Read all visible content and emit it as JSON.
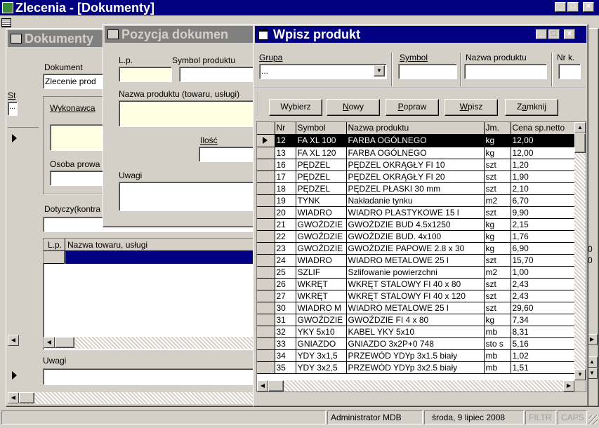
{
  "app": {
    "title": "Zlecenia - [Dokumenty]",
    "status": {
      "user": "Administrator MDB",
      "date": "środa, 9 lipiec 2008",
      "filtr": "FILTR",
      "caps": "CAPS"
    }
  },
  "dokumenty": {
    "title": "Dokumenty",
    "dokument_label": "Dokument",
    "dokument_value": "Zlecenie prod",
    "st_label": "St",
    "st_value": "...",
    "wykonawca_label": "Wykonawca",
    "osoba_label": "Osoba prowa",
    "dotyczy_label": "Dotyczy(kontra",
    "lp_header": "L.p.",
    "nazwa_header": "Nazwa towaru, usługi",
    "uwagi_label": "Uwagi"
  },
  "pozycja": {
    "title": "Pozycja dokumen",
    "lp_label": "L.p.",
    "symbol_label": "Symbol produktu",
    "nazwa_label": "Nazwa produktu (towaru, usługi)",
    "ilosc_label": "Ilość",
    "uwagi_label": "Uwagi"
  },
  "wpisz": {
    "title": "Wpisz produkt",
    "grupa_label": "Grupa",
    "grupa_value": "...",
    "symbol_label": "Symbol",
    "nazwa_label": "Nazwa produktu",
    "nrk_label": "Nr k.",
    "buttons": {
      "wybierz": "Wybierz",
      "nowy": "Nowy",
      "popraw": "Popraw",
      "wpisz": "Wpisz",
      "zamknij": "Zamknij"
    },
    "columns": [
      "Nr",
      "Symbol",
      "Nazwa produktu",
      "Jm.",
      "Cena sp.netto"
    ],
    "rows": [
      [
        "12",
        "FA XL 100",
        "FARBA OGÓLNEGO",
        "kg",
        "12,00"
      ],
      [
        "13",
        "FA XL 120",
        "FARBA OGÓLNEGO",
        "kg",
        "12,00"
      ],
      [
        "16",
        "PĘDZEL",
        "PĘDZEL OKRĄGŁY FI 10",
        "szt",
        "1,20"
      ],
      [
        "17",
        "PĘDZEL",
        "PĘDZEL OKRĄGŁY FI 20",
        "szt",
        "1,90"
      ],
      [
        "18",
        "PĘDZEL",
        "PĘDZEL PŁASKI 30 mm",
        "szt",
        "2,10"
      ],
      [
        "19",
        "TYNK",
        "Nakładanie tynku",
        "m2",
        "6,70"
      ],
      [
        "20",
        "WIADRO",
        "WIADRO PLASTYKOWE 15 l",
        "szt",
        "9,90"
      ],
      [
        "21",
        "GWOŹDZIE",
        "GWOŹDZIE BUD 4.5x1250",
        "kg",
        "2,15"
      ],
      [
        "22",
        "GWOŹDZIE",
        "GWOŹDZIE BUD. 4x100",
        "kg",
        "1,76"
      ],
      [
        "23",
        "GWOŹDZIE",
        "GWOŹDZIE PAPOWE 2.8 x 30",
        "kg",
        "6,90"
      ],
      [
        "24",
        "WIADRO",
        "WIADRO METALOWE 25 l",
        "szt",
        "15,70"
      ],
      [
        "25",
        "SZLIF",
        "Szlifowanie powierzchni",
        "m2",
        "1,00"
      ],
      [
        "26",
        "WKRĘT",
        "WKRĘT STALOWY FI 40 x 80",
        "szt",
        "2,43"
      ],
      [
        "27",
        "WKRĘT",
        "WKRĘT STALOWY FI 40 x 120",
        "szt",
        "2,43"
      ],
      [
        "30",
        "WIADRO M",
        "WIADRO METALOWE 25 l",
        "szt",
        "29,60"
      ],
      [
        "31",
        "GWOŹDZIE",
        "GWOŹDZIE FI 4 x 80",
        "kg",
        "7,34"
      ],
      [
        "32",
        "YKY 5x10",
        "KABEL YKY 5x10",
        "mb",
        "8,31"
      ],
      [
        "33",
        "GNIAZDO",
        "GNIAZDO 3x2P+0 748",
        "sto s",
        "5,16"
      ],
      [
        "34",
        "YDY 3x1,5",
        "PRZEWÓD YDYp 3x1.5 biały",
        "mb",
        "1,02"
      ],
      [
        "35",
        "YDY 3x2,5",
        "PRZEWÓD YDYp 3x2.5 biały",
        "mb",
        "1,51"
      ]
    ]
  },
  "bg_right": {
    "v1": "0",
    "v2": "0"
  }
}
